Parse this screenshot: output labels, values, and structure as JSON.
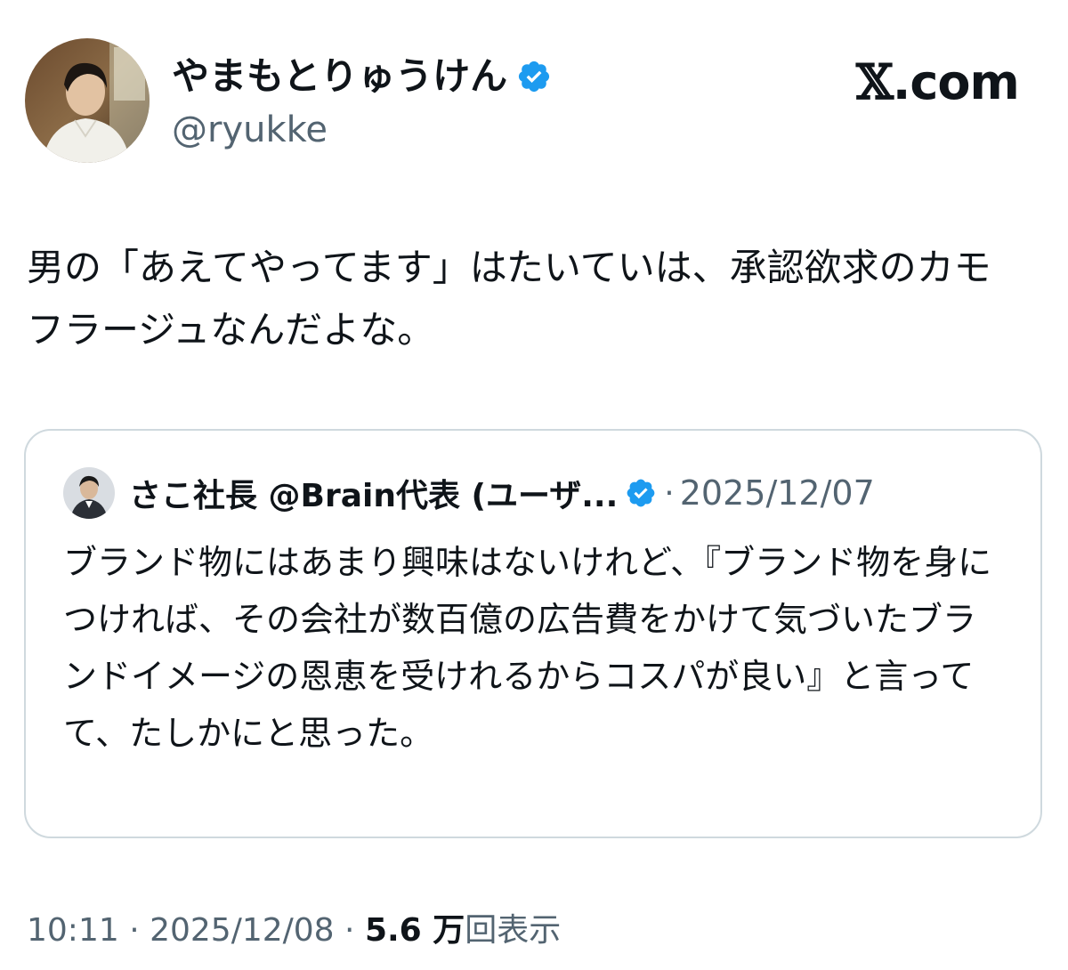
{
  "author": {
    "display_name": "やまもとりゅうけん",
    "handle": "@ryukke",
    "verified_icon": "verified-badge-icon"
  },
  "brand": {
    "x": "𝕏",
    "domain": ".com"
  },
  "tweet": {
    "text": "男の「あえてやってます」はたいていは、承認欲求のカモフラージュなんだよな。"
  },
  "quote": {
    "author_name": "さこ社長 @Brain代表 (ユーザ...",
    "separator": "·",
    "date": "2025/12/07",
    "text": "ブランド物にはあまり興味はないけれど、『ブランド物を身につければ、その会社が数百億の広告費をかけて気づいたブランドイメージの恩恵を受けれるからコスパが良い』と言ってて、たしかにと思った。"
  },
  "meta": {
    "time": "10:11",
    "sep1": " · ",
    "date": "2025/12/08",
    "sep2": " · ",
    "views_count": "5.6 万",
    "views_label": "回表示"
  },
  "colors": {
    "text_primary": "#0f1419",
    "text_secondary": "#536471",
    "verified_blue": "#1d9bf0",
    "card_border": "#cfd9de"
  }
}
